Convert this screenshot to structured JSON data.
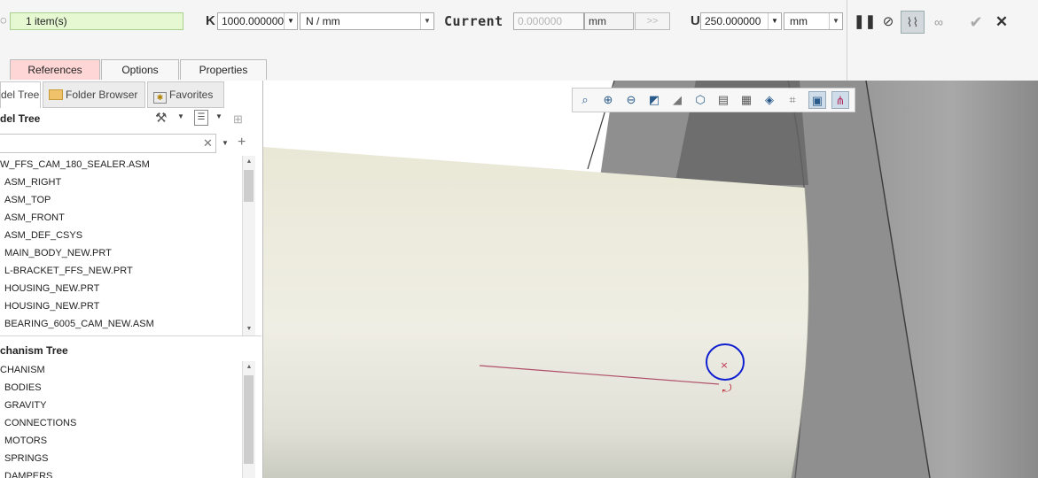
{
  "dashboard": {
    "selection": "1 item(s)",
    "k_label": "K",
    "k_value": "1000.000000",
    "k_unit": "N / mm",
    "current_label": "Current",
    "current_value": "0.000000",
    "current_unit": "mm",
    "arrow_button": ">>",
    "u_label": "U",
    "u_value": "250.000000",
    "u_unit": "mm",
    "tabs": [
      "References",
      "Options",
      "Properties"
    ],
    "accent_active_tab": "#ffd6d6",
    "selection_bg": "#e6f8d2"
  },
  "panel": {
    "tabs": [
      "del Tree",
      "Folder Browser",
      "Favorites"
    ],
    "model_tree_title": "del Tree",
    "model_tree_items": [
      "W_FFS_CAM_180_SEALER.ASM",
      "ASM_RIGHT",
      "ASM_TOP",
      "ASM_FRONT",
      "ASM_DEF_CSYS",
      "MAIN_BODY_NEW.PRT",
      "L-BRACKET_FFS_NEW.PRT",
      "HOUSING_NEW.PRT",
      "HOUSING_NEW.PRT",
      "BEARING_6005_CAM_NEW.ASM"
    ],
    "mechanism_title": "chanism Tree",
    "mechanism_items": [
      "CHANISM",
      "BODIES",
      "GRAVITY",
      "CONNECTIONS",
      "MOTORS",
      "SPRINGS",
      "DAMPERS"
    ]
  },
  "viewport_toolbar": {
    "icons": [
      "refit-icon",
      "zoom-in-icon",
      "zoom-out-icon",
      "repaint-icon",
      "perspective-icon",
      "display-style-icon",
      "named-views-icon",
      "saved-orientations-icon",
      "view-manager-icon",
      "datum-display-icon",
      "annotation-display-icon",
      "spin-center-icon"
    ]
  },
  "colors": {
    "cylinder": "#ecebdd",
    "housing_dark": "#8d8d8d",
    "housing_mid": "#a6a6a6",
    "marker_circle": "#1020d0",
    "marker_line": "#b0506a"
  }
}
